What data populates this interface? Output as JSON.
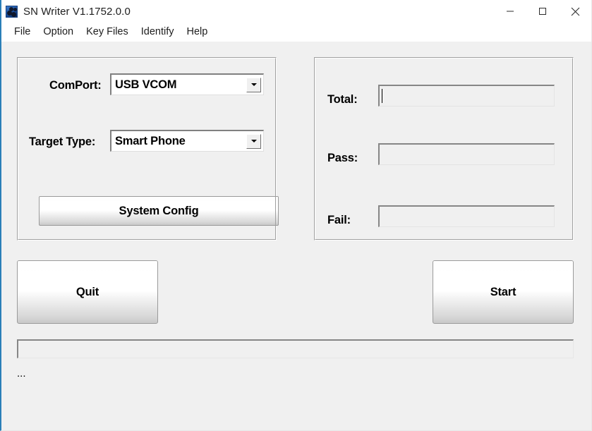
{
  "window": {
    "title": "SN Writer V1.1752.0.0",
    "icon": "app-logo-icon",
    "controls": {
      "minimize": "minimize-icon",
      "maximize": "maximize-icon",
      "close": "close-icon"
    },
    "accent_color": "#2a7fb8",
    "background_color": "#f0f0f0"
  },
  "menu": {
    "items": [
      {
        "label": "File"
      },
      {
        "label": "Option"
      },
      {
        "label": "Key Files"
      },
      {
        "label": "Identify"
      },
      {
        "label": "Help"
      }
    ]
  },
  "device_group": {
    "comport": {
      "label": "ComPort:",
      "value": "USB VCOM",
      "arrow_icon": "chevron-down-icon"
    },
    "target_type": {
      "label": "Target Type:",
      "value": "Smart Phone",
      "arrow_icon": "chevron-down-icon"
    },
    "system_config_label": "System Config"
  },
  "counts_group": {
    "total": {
      "label": "Total:",
      "value": ""
    },
    "pass": {
      "label": "Pass:",
      "value": ""
    },
    "fail": {
      "label": "Fail:",
      "value": ""
    }
  },
  "actions": {
    "quit_label": "Quit",
    "start_label": "Start"
  },
  "progress": {
    "percent": 0,
    "fill_color": "#06b025"
  },
  "status": {
    "text": "..."
  }
}
